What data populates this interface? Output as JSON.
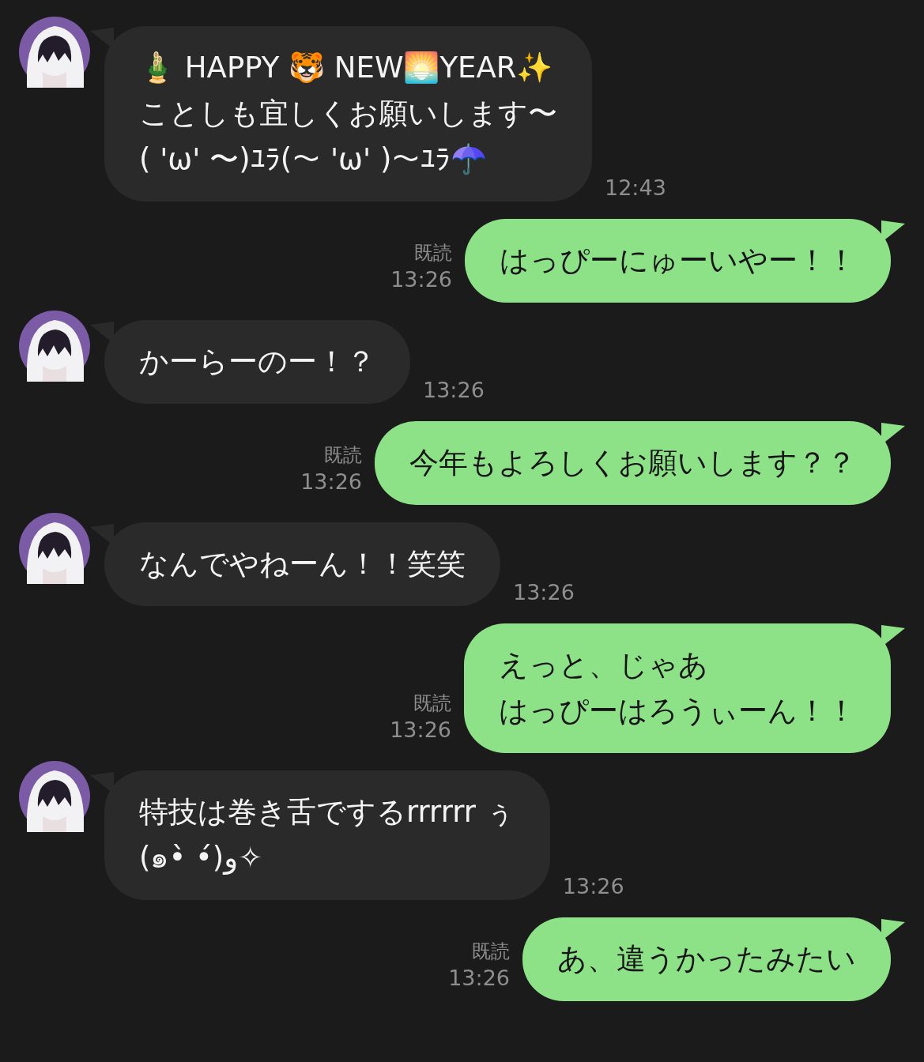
{
  "messages": [
    {
      "kind": "received",
      "lines": [
        "🎍 HAPPY 🐯 NEW🌅YEAR✨",
        "ことしも宜しくお願いします〜",
        "( 'ω' 〜)ﾕﾗ(〜 'ω' )〜ﾕﾗ☂️"
      ],
      "time": "12:43"
    },
    {
      "kind": "sent",
      "lines": [
        "はっぴーにゅーいやー！！"
      ],
      "read": "既読",
      "time": "13:26"
    },
    {
      "kind": "received",
      "lines": [
        "かーらーのー！？"
      ],
      "time": "13:26"
    },
    {
      "kind": "sent",
      "lines": [
        "今年もよろしくお願いします？？"
      ],
      "read": "既読",
      "time": "13:26"
    },
    {
      "kind": "received",
      "lines": [
        "なんでやねーん！！笑笑"
      ],
      "time": "13:26"
    },
    {
      "kind": "sent",
      "lines": [
        "えっと、じゃあ",
        "はっぴーはろうぃーん！！"
      ],
      "read": "既読",
      "time": "13:26"
    },
    {
      "kind": "received",
      "lines": [
        "特技は巻き舌でするrrrrrr ぅ",
        "(๑•̀ •́)و✧"
      ],
      "time": "13:26"
    },
    {
      "kind": "sent",
      "lines": [
        "あ、違うかったみたい"
      ],
      "read": "既読",
      "time": "13:26"
    }
  ]
}
